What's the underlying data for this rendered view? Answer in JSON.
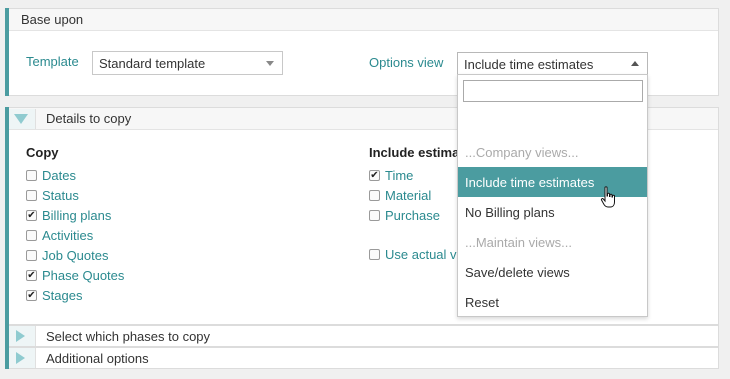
{
  "base_upon": {
    "header": "Base upon",
    "template_label": "Template",
    "template_value": "Standard template",
    "options_view_label": "Options view",
    "options_view_value": "Include time estimates"
  },
  "details": {
    "header": "Details to copy",
    "copy_heading": "Copy",
    "copy_items": [
      {
        "label": "Dates",
        "checked": false
      },
      {
        "label": "Status",
        "checked": false
      },
      {
        "label": "Billing plans",
        "checked": true
      },
      {
        "label": "Activities",
        "checked": false
      },
      {
        "label": "Job Quotes",
        "checked": false
      },
      {
        "label": "Phase Quotes",
        "checked": true
      },
      {
        "label": "Stages",
        "checked": true
      }
    ],
    "estimates_heading": "Include estima",
    "estimate_items": [
      {
        "label": "Time",
        "checked": true
      },
      {
        "label": "Material",
        "checked": false
      },
      {
        "label": "Purchase",
        "checked": false
      }
    ],
    "use_actual_label": "Use actual v",
    "use_actual_checked": false
  },
  "sections": {
    "phases": "Select which phases to copy",
    "additional": "Additional options"
  },
  "dropdown": {
    "search_value": "",
    "options": [
      {
        "label": "...Company views...",
        "type": "group"
      },
      {
        "label": "Include time estimates",
        "type": "selected"
      },
      {
        "label": "No Billing plans",
        "type": "option"
      },
      {
        "label": "...Maintain views...",
        "type": "group"
      },
      {
        "label": "Save/delete views",
        "type": "option"
      },
      {
        "label": "Reset",
        "type": "option"
      }
    ]
  },
  "icons": {
    "checkmark": "✔",
    "expand": "triangle-right-icon",
    "collapse": "triangle-down-icon",
    "cursor": "hand-pointer-icon"
  },
  "colors": {
    "accent": "#4b9ca0",
    "link_text": "#2b8a8f",
    "selected_bg": "#4b9ca0"
  }
}
